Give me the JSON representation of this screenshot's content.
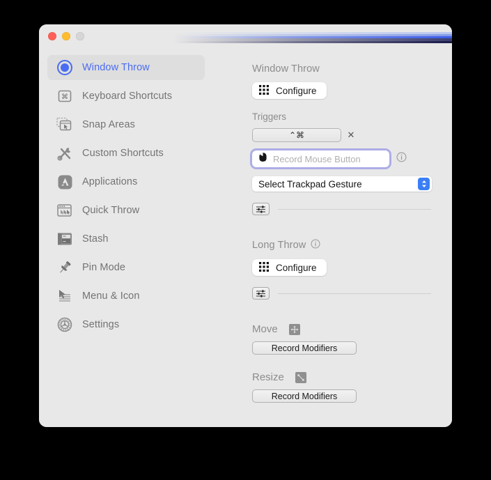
{
  "window": {
    "traffic_lights": [
      "close",
      "minimize",
      "zoom"
    ]
  },
  "sidebar": {
    "items": [
      {
        "id": "window-throw",
        "label": "Window Throw",
        "icon": "target-circle-icon",
        "selected": true
      },
      {
        "id": "keyboard-shortcuts",
        "label": "Keyboard Shortcuts",
        "icon": "keyboard-key-icon",
        "selected": false
      },
      {
        "id": "snap-areas",
        "label": "Snap Areas",
        "icon": "snap-areas-icon",
        "selected": false
      },
      {
        "id": "custom-shortcuts",
        "label": "Custom Shortcuts",
        "icon": "wrench-screwdriver-icon",
        "selected": false
      },
      {
        "id": "applications",
        "label": "Applications",
        "icon": "app-store-icon",
        "selected": false
      },
      {
        "id": "quick-throw",
        "label": "Quick Throw",
        "icon": "quick-throw-icon",
        "selected": false
      },
      {
        "id": "stash",
        "label": "Stash",
        "icon": "stash-drawer-icon",
        "selected": false
      },
      {
        "id": "pin-mode",
        "label": "Pin Mode",
        "icon": "pushpin-icon",
        "selected": false
      },
      {
        "id": "menu-icon",
        "label": "Menu & Icon",
        "icon": "cursor-menu-icon",
        "selected": false
      },
      {
        "id": "settings",
        "label": "Settings",
        "icon": "gear-icon",
        "selected": false
      }
    ]
  },
  "content": {
    "window_throw": {
      "title": "Window Throw",
      "configure_label": "Configure",
      "triggers_label": "Triggers",
      "trigger_value": "⌃⌘",
      "trigger_clear": "✕",
      "record_mouse_placeholder": "Record Mouse Button",
      "trackpad_gesture_value": "Select Trackpad Gesture"
    },
    "long_throw": {
      "title": "Long Throw",
      "configure_label": "Configure"
    },
    "move": {
      "label": "Move",
      "icon": "move-arrows-icon",
      "record_modifiers_label": "Record Modifiers"
    },
    "resize": {
      "label": "Resize",
      "icon": "resize-diagonal-icon",
      "record_modifiers_label": "Record Modifiers"
    }
  },
  "colors": {
    "accent_blue": "#4a6cf2",
    "stepper_blue": "#3b7ef5",
    "focus_ring": "#7b7be6",
    "window_bg": "#e8e8e8"
  }
}
